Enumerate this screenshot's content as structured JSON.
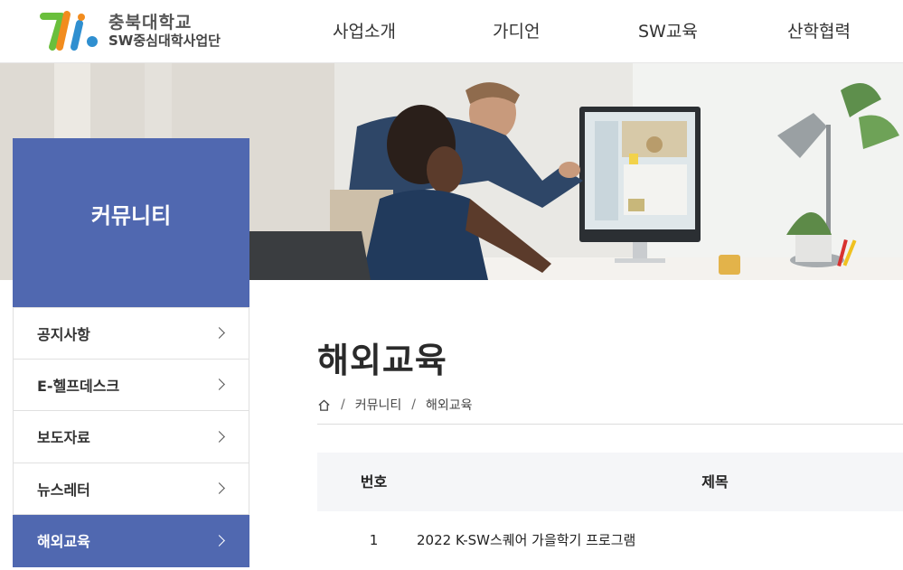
{
  "header": {
    "logo_title": "충북대학교",
    "logo_sub": "SW중심대학사업단",
    "nav": [
      "사업소개",
      "가디언",
      "SW교육",
      "산학협력"
    ]
  },
  "side": {
    "title": "커뮤니티",
    "items": [
      {
        "label": "공지사항"
      },
      {
        "label": "E-헬프데스크"
      },
      {
        "label": "보도자료"
      },
      {
        "label": "뉴스레터"
      },
      {
        "label": "해외교육"
      }
    ]
  },
  "content": {
    "title": "해외교육",
    "breadcrumb": [
      "커뮤니티",
      "해외교육"
    ],
    "table": {
      "headers": [
        "번호",
        "제목"
      ],
      "rows": [
        {
          "no": "1",
          "title": "2022 K-SW스퀘어 가을학기 프로그램"
        }
      ]
    }
  },
  "colors": {
    "accent": "#5068b0",
    "logo_green": "#6abf3c",
    "logo_orange": "#f28c1e",
    "logo_blue": "#2f8fd0"
  }
}
